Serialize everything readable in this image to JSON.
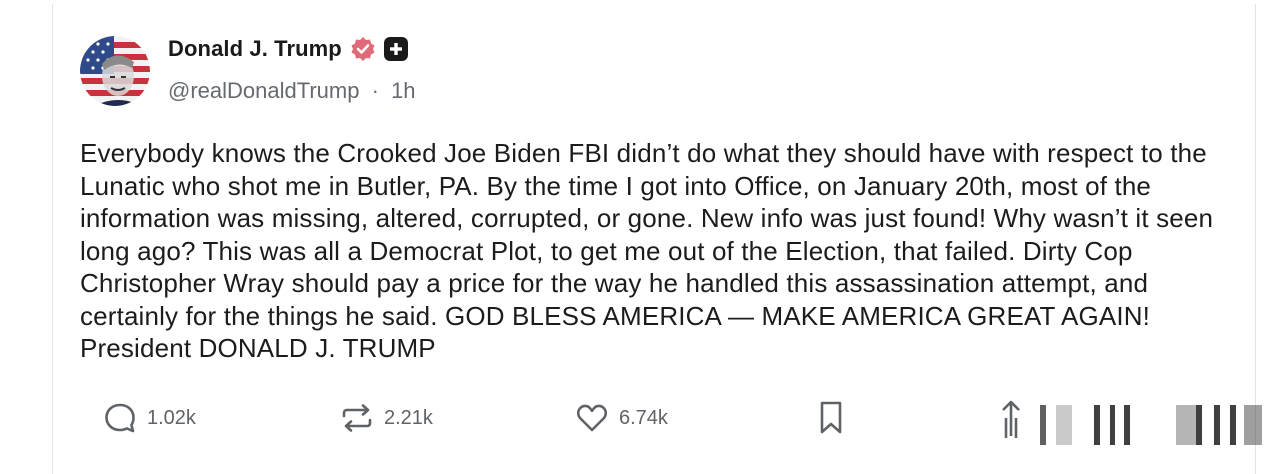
{
  "post": {
    "author_name": "Donald J. Trump",
    "handle": "@realDonaldTrump",
    "separator": "·",
    "time_ago": "1h",
    "text": "Everybody knows the Crooked Joe Biden FBI didn’t do what they should have with respect to the Lunatic who shot me in Butler, PA. By the time I got into Office, on January 20th, most of the information was missing, altered, corrupted, or gone. New info was just found! Why wasn’t it seen long ago? This was all a Democrat Plot, to get me out of the Election, that failed. Dirty Cop Christopher Wray should pay a price for the way he handled this assassination attempt, and certainly for the things he said. GOD BLESS AMERICA — MAKE AMERICA GREAT AGAIN! President DONALD J. TRUMP"
  },
  "actions": {
    "replies": "1.02k",
    "reposts": "2.21k",
    "likes": "6.74k"
  },
  "icons": {
    "verified": "verified-badge-icon",
    "plus": "plus-badge-icon",
    "reply": "reply-bubble-icon",
    "repost": "repost-icon",
    "like": "heart-icon",
    "bookmark": "bookmark-icon",
    "share": "share-icon"
  },
  "colors": {
    "verified": "#e06b78",
    "text": "#1c1c1c",
    "muted": "#666a70",
    "icon": "#5f6368"
  }
}
